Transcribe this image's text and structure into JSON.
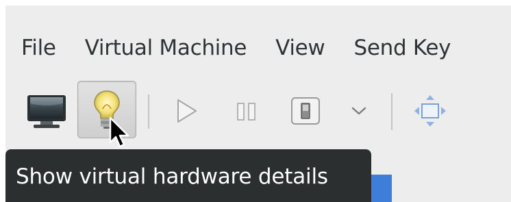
{
  "menubar": {
    "items": [
      {
        "label": "File"
      },
      {
        "label": "Virtual Machine"
      },
      {
        "label": "View"
      },
      {
        "label": "Send Key"
      }
    ]
  },
  "toolbar": {
    "buttons": [
      {
        "name": "console-button",
        "icon": "monitor-icon",
        "active": false
      },
      {
        "name": "details-button",
        "icon": "lightbulb-icon",
        "active": true
      },
      {
        "name": "run-button",
        "icon": "play-icon",
        "active": false
      },
      {
        "name": "pause-button",
        "icon": "pause-icon",
        "active": false
      },
      {
        "name": "shutdown-button",
        "icon": "power-icon",
        "active": false
      },
      {
        "name": "shutdown-menu-button",
        "icon": "chevron-down-icon",
        "active": false
      },
      {
        "name": "fullscreen-button",
        "icon": "fullscreen-arrows-icon",
        "active": false
      }
    ]
  },
  "tooltip": {
    "text": "Show virtual hardware details"
  },
  "colors": {
    "window_bg": "#ededed",
    "tooltip_bg": "#2b2f30",
    "tooltip_text": "#ffffff",
    "selection": "#3d7fd8"
  }
}
